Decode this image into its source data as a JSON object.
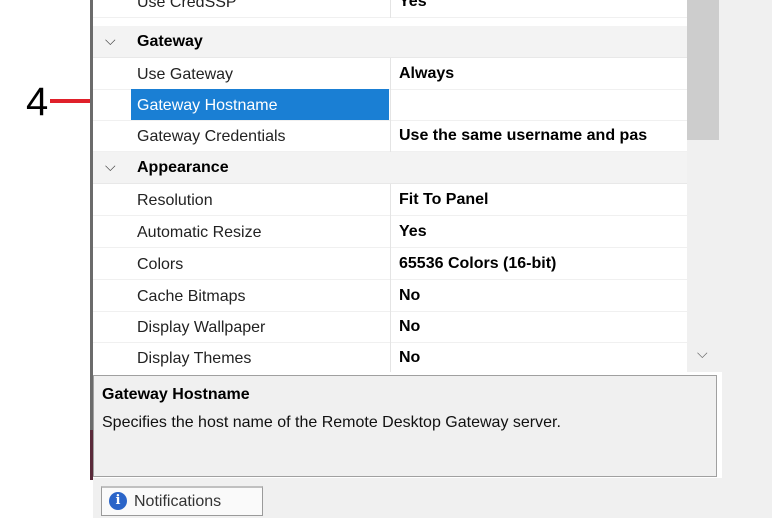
{
  "annotation": {
    "number": "4"
  },
  "properties": {
    "rows": [
      {
        "type": "prop",
        "name": "Use CredSSP",
        "value": "Yes"
      },
      {
        "type": "category",
        "name": "Gateway"
      },
      {
        "type": "prop",
        "name": "Use Gateway",
        "value": "Always"
      },
      {
        "type": "prop",
        "name": "Gateway Hostname",
        "value": "",
        "selected": true
      },
      {
        "type": "prop",
        "name": "Gateway Credentials",
        "value": "Use the same username and pas"
      },
      {
        "type": "category",
        "name": "Appearance"
      },
      {
        "type": "prop",
        "name": "Resolution",
        "value": "Fit To Panel"
      },
      {
        "type": "prop",
        "name": "Automatic Resize",
        "value": "Yes"
      },
      {
        "type": "prop",
        "name": "Colors",
        "value": "65536 Colors (16-bit)"
      },
      {
        "type": "prop",
        "name": "Cache Bitmaps",
        "value": "No"
      },
      {
        "type": "prop",
        "name": "Display Wallpaper",
        "value": "No"
      },
      {
        "type": "prop",
        "name": "Display Themes",
        "value": "No"
      }
    ]
  },
  "description": {
    "title": "Gateway Hostname",
    "text": "Specifies the host name of the Remote Desktop Gateway server."
  },
  "tabs": {
    "notifications": {
      "label": "Notifications",
      "icon": "info-icon"
    }
  },
  "icons": {
    "category_toggle": "chevron-down-icon",
    "scroll_down": "scroll-down-arrow-icon"
  },
  "colors": {
    "selection": "#1a7fd4",
    "callout": "#e0202a"
  }
}
